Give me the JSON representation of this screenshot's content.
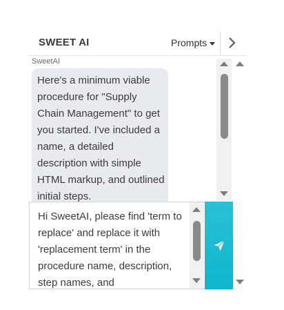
{
  "header": {
    "title": "SWEET AI",
    "prompts_label": "Prompts"
  },
  "chat": {
    "sender": "SweetAI",
    "message": "Here's a minimum viable procedure for \"Supply Chain Management\" to get you started. I've included a name, a detailed description with simple HTML markup, and outlined initial steps."
  },
  "input": {
    "value": "Hi SweetAI, please find 'term to replace' and replace it with 'replacement term' in the procedure name, description, step names, and"
  },
  "icons": {
    "expand": "chevron-right-icon",
    "send": "send-icon",
    "prompts_caret": "caret-down-icon"
  },
  "colors": {
    "send_button": "#1ab9d1",
    "bubble": "#e7eaee",
    "scroll_thumb": "#8a8a8a"
  }
}
